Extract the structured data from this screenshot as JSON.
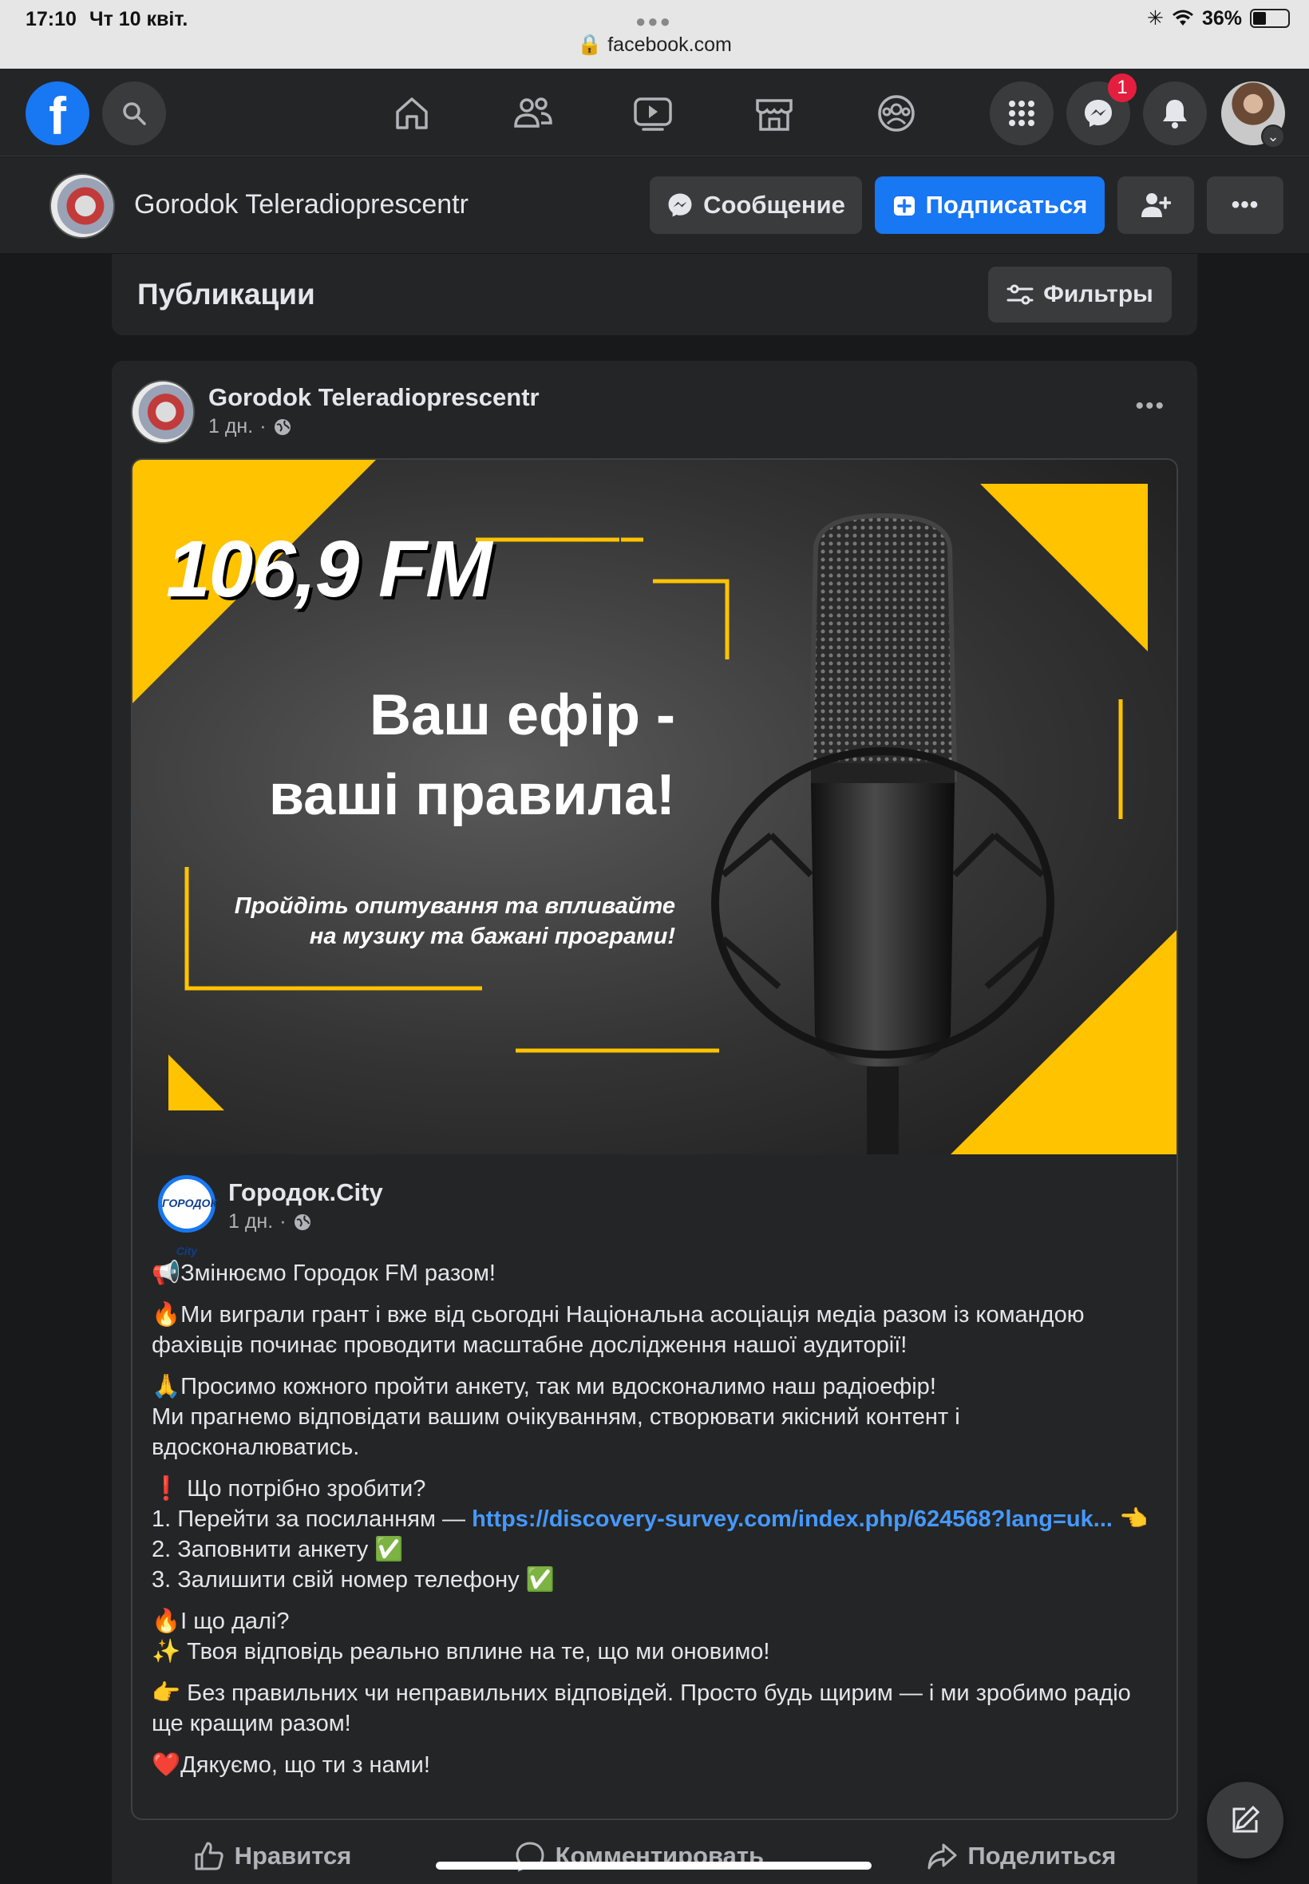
{
  "status_bar": {
    "time": "17:10",
    "date": "Чт 10 квіт.",
    "battery": "36%",
    "url": "facebook.com"
  },
  "nav": {
    "logo": "f",
    "messenger_badge": "1",
    "icons": [
      "search-icon",
      "home-icon",
      "friends-icon",
      "watch-icon",
      "marketplace-icon",
      "groups-icon",
      "menu-grid-icon",
      "messenger-icon",
      "bell-icon"
    ]
  },
  "page": {
    "name": "Gorodok Teleradioprescentr",
    "message_btn": "Сообщение",
    "follow_btn": "Подписаться"
  },
  "publications": {
    "title": "Публикации",
    "filter_btn": "Фильтры"
  },
  "post": {
    "author": "Gorodok Teleradioprescentr",
    "time": "1 дн.",
    "banner": {
      "frequency": "106,9 FM",
      "headline_1": "Ваш ефір -",
      "headline_2": "ваші правила!",
      "sub_1": "Пройдіть опитування та впливайте",
      "sub_2": "на музику та бажані програми!"
    },
    "shared": {
      "author": "Городок.City",
      "time": "1 дн.",
      "avatar_text": "ГОРОДОК City"
    },
    "text": {
      "p1": "📢Змінюємо  Городок FM разом!",
      "p2": "🔥Ми виграли грант і вже від сьогодні Національна асоціація медіа разом із командою фахівців починає проводити масштабне дослідження нашої аудиторії!",
      "p3a": "🙏Просимо кожного пройти анкету, так ми вдосконалимо наш радіоефір!",
      "p3b": "Ми прагнемо відповідати вашим очікуванням, створювати якісний контент і вдосконалюватись.",
      "p4a": "❗ Що потрібно зробити?",
      "p4b_prefix": "1. Перейти за посиланням  — ",
      "p4b_link": "https://discovery-survey.com/index.php/624568?lang=uk...",
      "p4b_suffix": " 👈",
      "p4c": "2. Заповнити анкету ✅",
      "p4d": "3. Залишити свій номер телефону ✅",
      "p5a": "🔥І що далі?",
      "p5b": "✨ Твоя відповідь реально вплине на те, що ми оновимо!",
      "p6": "👉 Без правильних чи неправильних відповідей. Просто будь щирим — і ми зробимо радіо ще кращим разом!",
      "p7": "❤️Дякуємо, що ти з нами!"
    },
    "actions": {
      "like": "Нравится",
      "comment": "Комментировать",
      "share": "Поделиться"
    }
  },
  "colors": {
    "accent": "#1877f2",
    "banner_yellow": "#ffc300",
    "link": "#4599ff"
  }
}
